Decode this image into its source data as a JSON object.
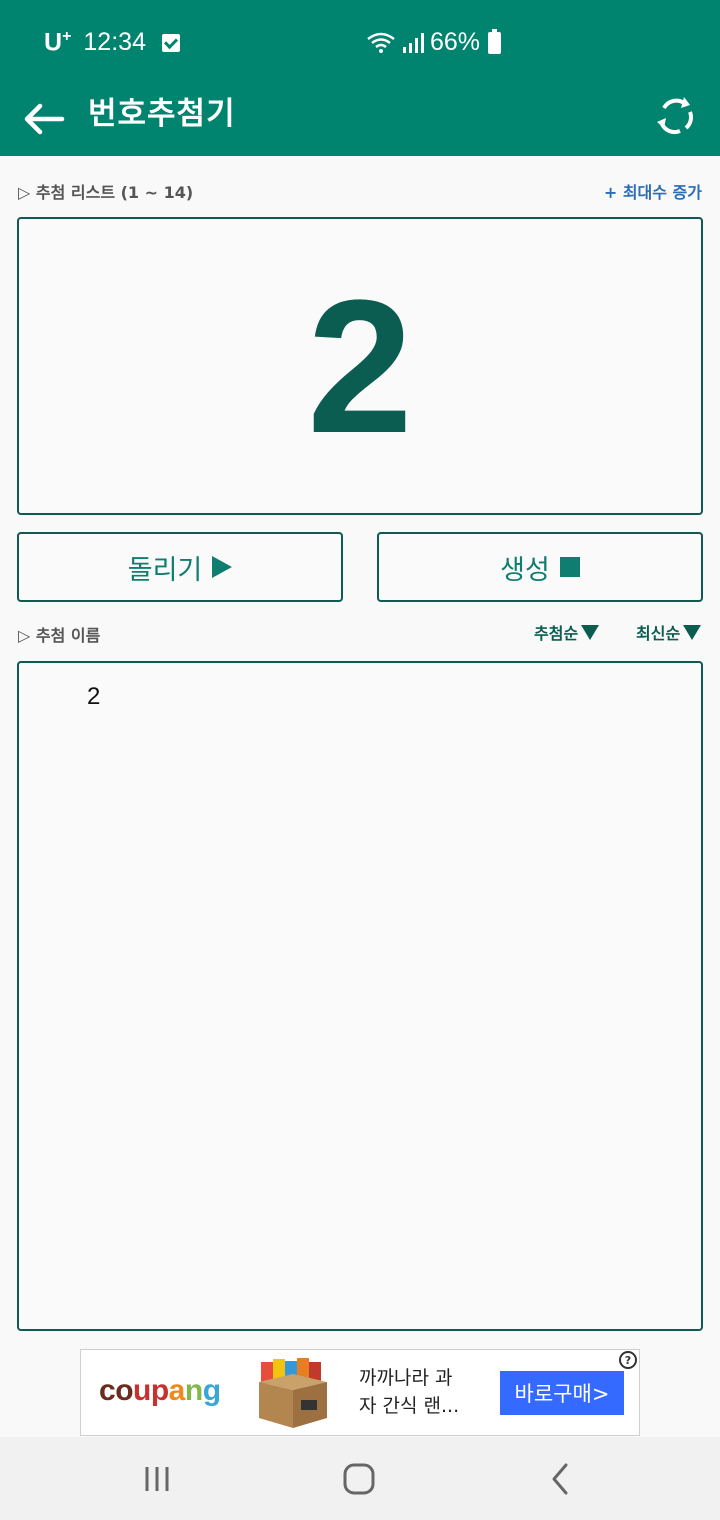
{
  "status_bar": {
    "carrier": "U",
    "carrier_plus": "+",
    "time": "12:34",
    "battery": "66%"
  },
  "app_bar": {
    "title": "번호추첨기",
    "back_icon": "arrow-left-icon",
    "refresh_icon": "refresh-icon"
  },
  "draw_list": {
    "label": "▷ 추첨 리스트 (1 ~ 14)",
    "increase_link": "+ 최대수 증가"
  },
  "result": {
    "number": "2"
  },
  "buttons": {
    "spin": "돌리기",
    "generate": "생성"
  },
  "names": {
    "label": "▷ 추첨 이름",
    "sort_draw": "추첨순",
    "sort_latest": "최신순",
    "items": [
      "2"
    ]
  },
  "ad": {
    "logo": "coupang",
    "text": "까까나라 과자 간식 랜...",
    "cta": "바로구매>",
    "help": "?",
    "colors": [
      "#6b2b1f",
      "#c7322f",
      "#ef8a1b",
      "#84b74a",
      "#38a7d8"
    ]
  },
  "nav": {
    "recents_icon": "recents-icon",
    "home_icon": "home-icon",
    "back_icon": "nav-back-icon"
  },
  "colors": {
    "primary": "#00846f",
    "border": "#0d5c52",
    "link": "#2c6db5",
    "cta": "#346aff"
  }
}
